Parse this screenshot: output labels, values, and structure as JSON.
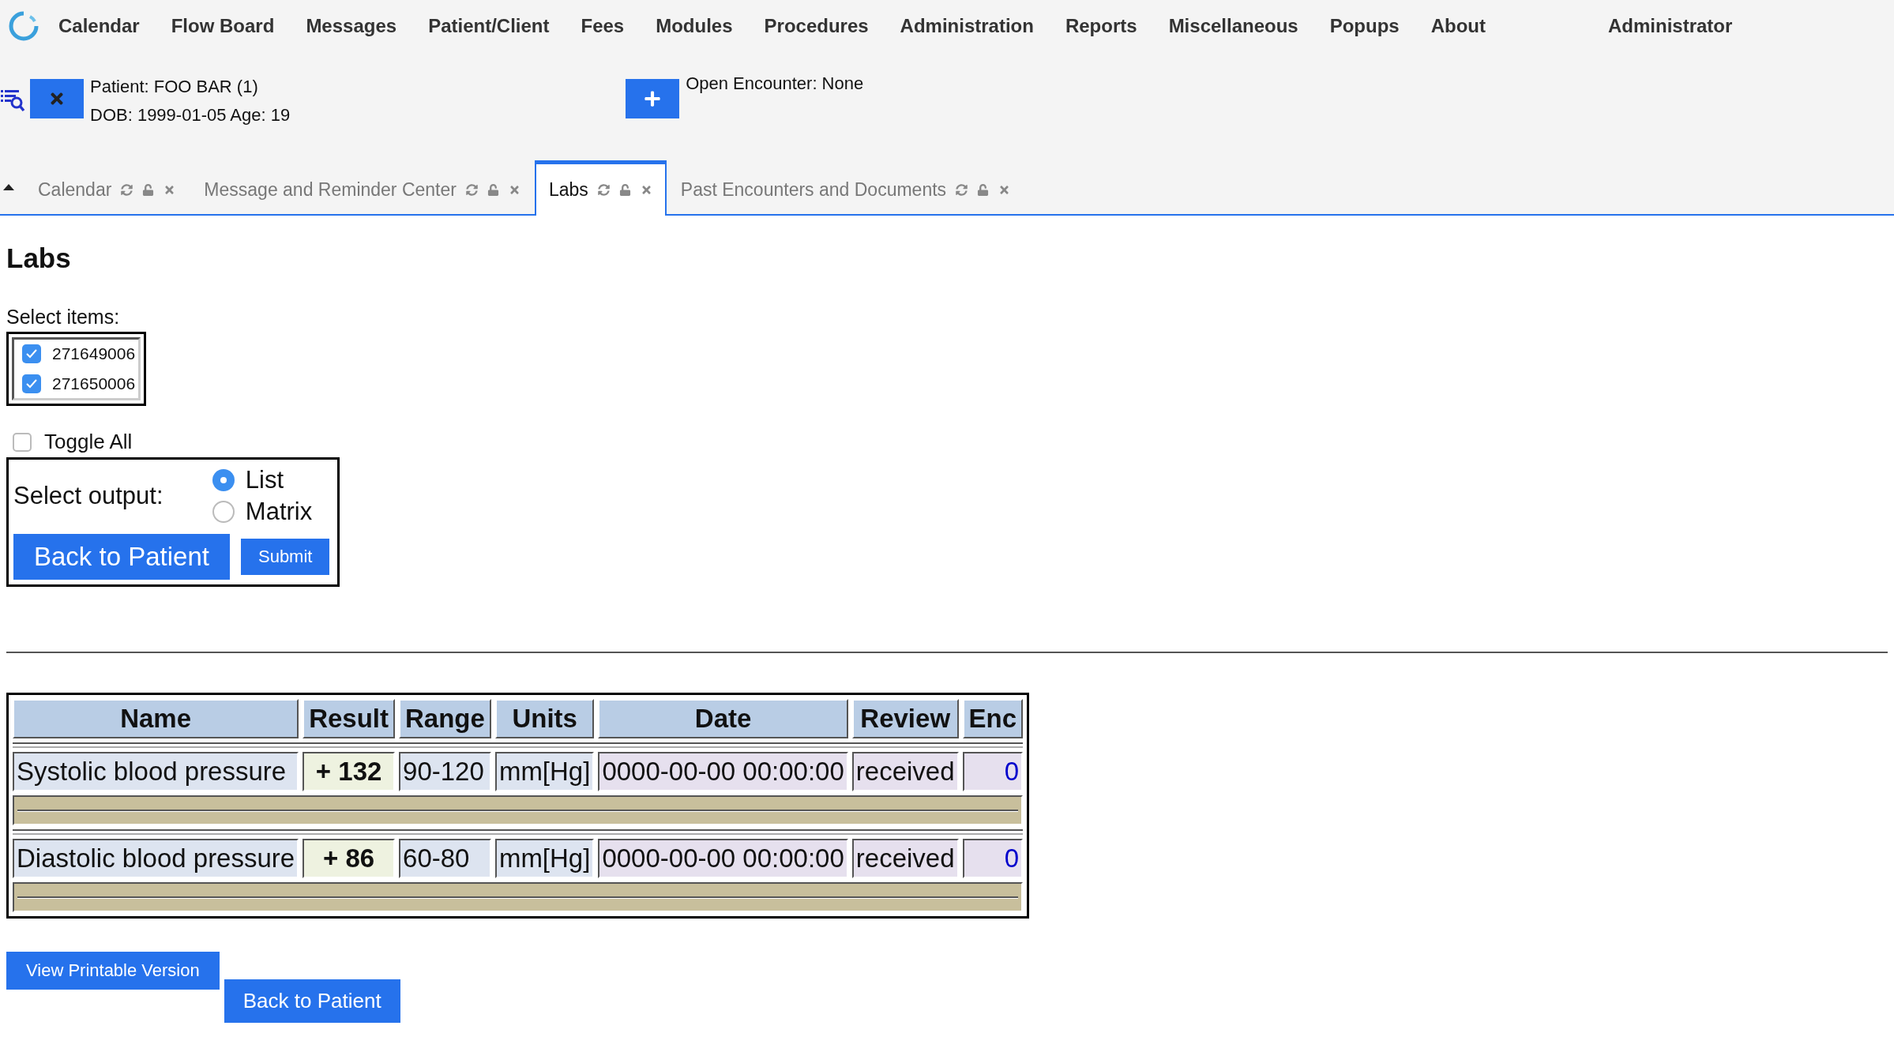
{
  "menu": [
    {
      "label": "Calendar"
    },
    {
      "label": "Flow Board"
    },
    {
      "label": "Messages"
    },
    {
      "label": "Patient/Client"
    },
    {
      "label": "Fees"
    },
    {
      "label": "Modules"
    },
    {
      "label": "Procedures"
    },
    {
      "label": "Administration"
    },
    {
      "label": "Reports"
    },
    {
      "label": "Miscellaneous"
    },
    {
      "label": "Popups"
    },
    {
      "label": "About"
    }
  ],
  "user": "Administrator",
  "patient": {
    "name_line": "Patient: FOO BAR (1)",
    "dob_line": "DOB: 1999-01-05 Age: 19"
  },
  "encounter": "Open Encounter: None",
  "tabs": [
    {
      "label": "Calendar",
      "selected": false
    },
    {
      "label": "Message and Reminder Center",
      "selected": false
    },
    {
      "label": "Labs",
      "selected": true
    },
    {
      "label": "Past Encounters and Documents",
      "selected": false
    }
  ],
  "title": "Labs",
  "select_items": {
    "label": "Select items:",
    "items": [
      {
        "label": "271649006",
        "checked": true
      },
      {
        "label": "271650006",
        "checked": true
      }
    ]
  },
  "toggle_all": {
    "label": "Toggle All",
    "checked": false
  },
  "output": {
    "label": "Select output:",
    "options": [
      {
        "label": "List",
        "selected": true
      },
      {
        "label": "Matrix",
        "selected": false
      }
    ]
  },
  "form_buttons": [
    "Back to Patient",
    "Submit"
  ],
  "table": {
    "columns": [
      "Name",
      "Result",
      "Range",
      "Units",
      "Date",
      "Review",
      "Enc"
    ],
    "rows": [
      {
        "name": "Systolic blood pressure",
        "result": "+ 132",
        "range": "90-120",
        "units": "mm[Hg]",
        "date": "0000-00-00 00:00:00",
        "review": "received",
        "enc": "0"
      },
      {
        "name": "Diastolic blood pressure",
        "result": "+ 86",
        "range": "60-80",
        "units": "mm[Hg]",
        "date": "0000-00-00 00:00:00",
        "review": "received",
        "enc": "0"
      }
    ]
  },
  "bottom_buttons": [
    "View Printable Version",
    "Back to Patient"
  ]
}
